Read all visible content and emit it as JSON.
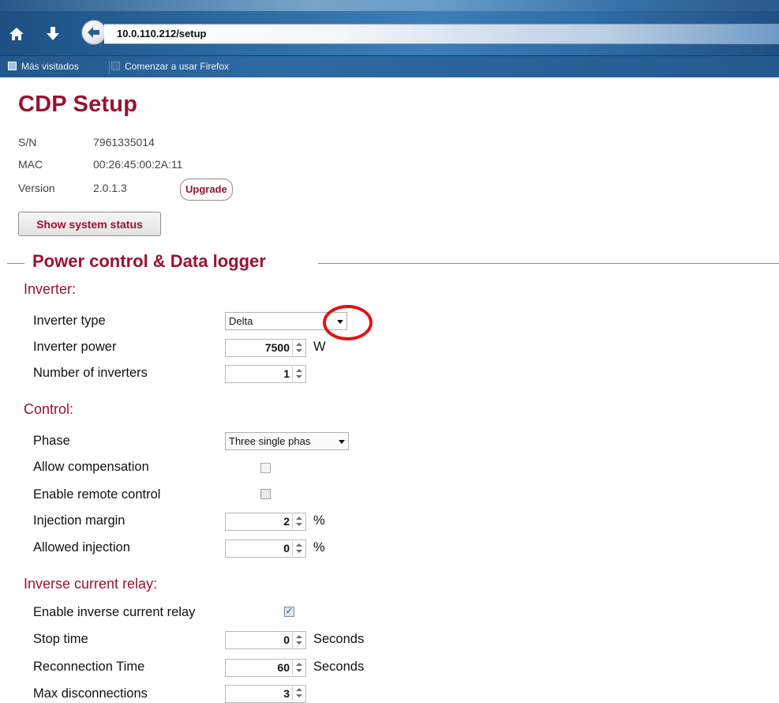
{
  "browser": {
    "url": "10.0.110.212/setup",
    "bookmarks": [
      "Más visitados",
      "Comenzar a usar Firefox"
    ]
  },
  "device": {
    "title": "CDP Setup",
    "sn_label": "S/N",
    "sn_value": "7961335014",
    "mac_label": "MAC",
    "mac_value": "00:26:45:00:2A:11",
    "version_label": "Version",
    "version_value": "2.0.1.3",
    "upgrade_label": "Upgrade",
    "status_button_label": "Show system status"
  },
  "section": {
    "title": "Power control & Data logger"
  },
  "inverter": {
    "heading": "Inverter:",
    "type_label": "Inverter type",
    "type_value": "Delta",
    "power_label": "Inverter power",
    "power_value": "7500",
    "power_unit": "W",
    "count_label": "Number of inverters",
    "count_value": "1"
  },
  "control": {
    "heading": "Control:",
    "phase_label": "Phase",
    "phase_value": "Three single phas",
    "allow_compensation_label": "Allow compensation",
    "allow_compensation_checked": false,
    "enable_remote_label": "Enable remote control",
    "enable_remote_checked": false,
    "injection_margin_label": "Injection margin",
    "injection_margin_value": "2",
    "injection_margin_unit": "%",
    "allowed_injection_label": "Allowed injection",
    "allowed_injection_value": "0",
    "allowed_injection_unit": "%"
  },
  "relay": {
    "heading": "Inverse current relay:",
    "enable_label": "Enable inverse current relay",
    "enable_checked": true,
    "stop_time_label": "Stop time",
    "stop_time_value": "0",
    "stop_time_unit": "Seconds",
    "reconnection_label": "Reconnection Time",
    "reconnection_value": "60",
    "reconnection_unit": "Seconds",
    "max_disconnections_label": "Max disconnections",
    "max_disconnections_value": "3"
  },
  "colors": {
    "accent": "#9b1230",
    "highlight_circle": "#e41111",
    "browser_blue": "#2b6aa3"
  },
  "icons": [
    "home-icon",
    "download-arrow-icon",
    "back-arrow-icon",
    "bookmark-page-icon",
    "bookmark-folder-icon",
    "dropdown-arrow-icon",
    "spinner-icon",
    "checkmark-icon"
  ]
}
